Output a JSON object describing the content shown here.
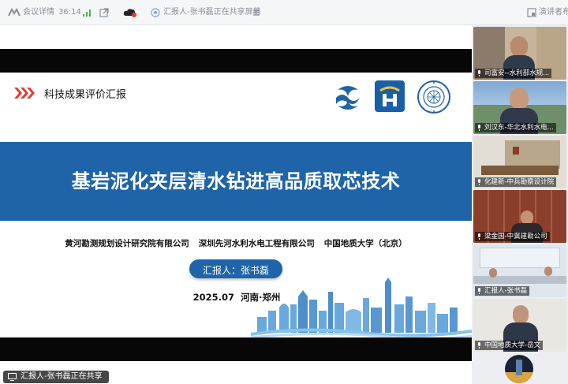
{
  "topbar": {
    "meeting_label": "会议详情",
    "duration": "36:14",
    "sharing_status": "汇报人-张书磊正在共享屏幕",
    "presenter_layout_label": "演讲者布局"
  },
  "slide": {
    "header_title": "科技成果评价汇报",
    "main_title": "基岩泥化夹层清水钻进高品质取芯技术",
    "organizations": [
      "黄河勘测规划设计研究院有限公司",
      "深圳先河水利水电工程有限公司",
      "中国地质大学（北京）"
    ],
    "reporter": "汇报人：张书磊",
    "date_place": "2025.07  河南·郑州",
    "logos": [
      "yrcc-logo",
      "company-logo",
      "cugb-seal"
    ],
    "accent_color": "#1f64a8"
  },
  "participants": [
    {
      "name": "司富安--水利部水规..."
    },
    {
      "name": "刘汉东-华北水利水电..."
    },
    {
      "name": "化建新-中兵勘察设计院"
    },
    {
      "name": "梁金国-中冀建勘公司"
    },
    {
      "name": "汇报人-张书磊"
    },
    {
      "name": "中国地质大学-岳文"
    }
  ],
  "share_indicator": "汇报人-张书磊正在共享"
}
